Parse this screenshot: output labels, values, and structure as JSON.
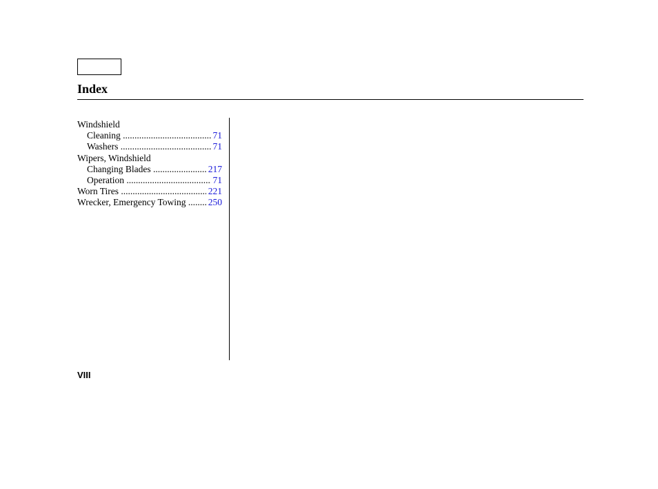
{
  "title": "Index",
  "entries": [
    {
      "label": "Windshield",
      "indent": 0,
      "page": null
    },
    {
      "label": "Cleaning",
      "indent": 1,
      "page": "71"
    },
    {
      "label": "Washers",
      "indent": 1,
      "page": "71"
    },
    {
      "label": "Wipers, Windshield",
      "indent": 0,
      "page": null
    },
    {
      "label": "Changing Blades",
      "indent": 1,
      "page": "217"
    },
    {
      "label": "Operation",
      "indent": 1,
      "page": "71"
    },
    {
      "label": "Worn Tires",
      "indent": 0,
      "page": "221"
    },
    {
      "label": "Wrecker, Emergency Towing",
      "indent": 0,
      "page": "250"
    }
  ],
  "page_number": "VIII"
}
